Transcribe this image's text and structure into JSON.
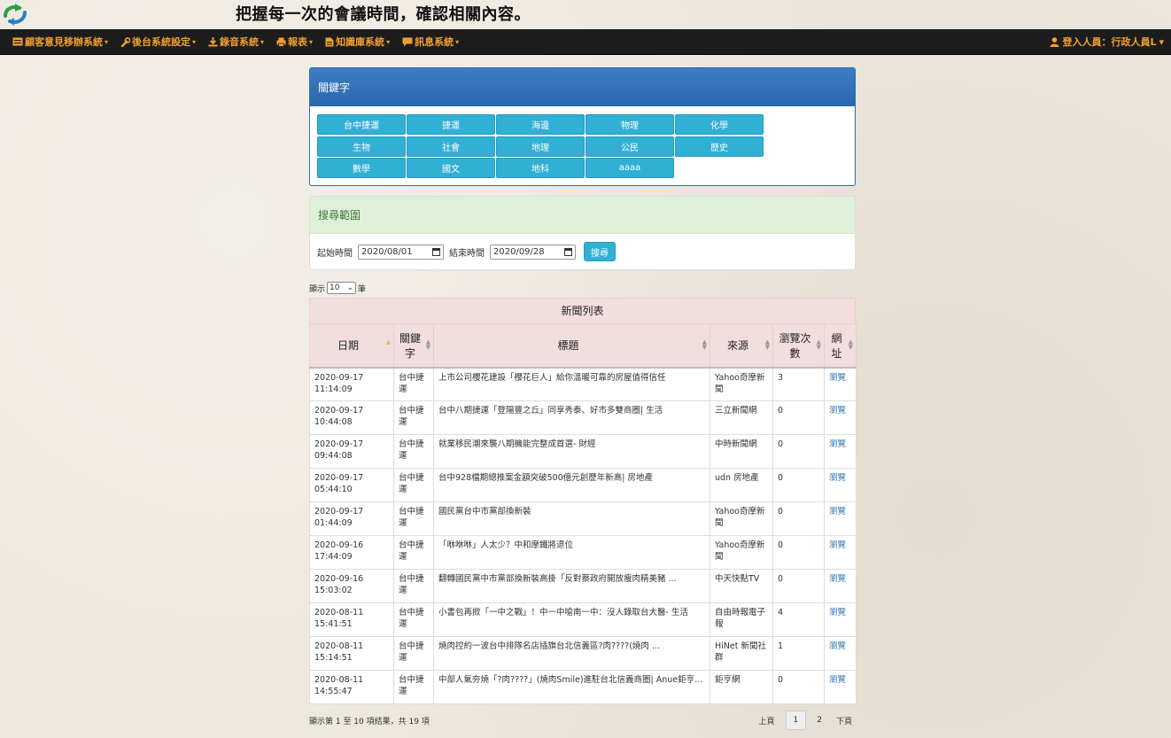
{
  "header": {
    "slogan": "把握每一次的會議時間，確認相關內容。"
  },
  "nav": {
    "items": [
      {
        "label": "顧客意見移辦系統",
        "icon": "card-icon"
      },
      {
        "label": "後台系統設定",
        "icon": "wrench-icon"
      },
      {
        "label": "錄音系統",
        "icon": "download-icon"
      },
      {
        "label": "報表",
        "icon": "printer-icon"
      },
      {
        "label": "知識庫系統",
        "icon": "document-icon"
      },
      {
        "label": "訊息系統",
        "icon": "comment-icon"
      }
    ],
    "caret": "▾",
    "user_label": "登入人員：行政人員L",
    "colors": {
      "bar": "#1c1c1c",
      "text": "#f0a030"
    }
  },
  "keywords": {
    "title": "關鍵字",
    "items": [
      "台中捷運",
      "捷運",
      "海邊",
      "物理",
      "化學",
      "生物",
      "社會",
      "地理",
      "公民",
      "歷史",
      "數學",
      "國文",
      "地科",
      "aaaa"
    ]
  },
  "search": {
    "title": "搜尋範圍",
    "start_label": "起始時間",
    "start_value": "2020/08/01",
    "end_label": "結束時間",
    "end_value": "2020/09/28",
    "button": "搜尋"
  },
  "length": {
    "prefix": "顯示",
    "value": "10",
    "suffix": "筆"
  },
  "table": {
    "title": "新聞列表",
    "columns": [
      "日期",
      "關鍵字",
      "標題",
      "來源",
      "瀏覽次數",
      "網址"
    ],
    "rows": [
      {
        "date": "2020-09-17 11:14:09",
        "keyword": "台中捷運",
        "title": "上市公司櫻花建設「櫻花巨人」給你溫暖可靠的房屋值得信任",
        "source": "Yahoo奇摩新聞",
        "views": "3",
        "url": "瀏覽"
      },
      {
        "date": "2020-09-17 10:44:08",
        "keyword": "台中捷運",
        "title": "台中八期捷運「登陽豐之丘」同享秀泰、好市多雙商圈| 生活",
        "source": "三立新聞網",
        "views": "0",
        "url": "瀏覽"
      },
      {
        "date": "2020-09-17 09:44:08",
        "keyword": "台中捷運",
        "title": "就業移民潮來襲八期機能完整成首選- 財經",
        "source": "中時新聞網",
        "views": "0",
        "url": "瀏覽"
      },
      {
        "date": "2020-09-17 05:44:10",
        "keyword": "台中捷運",
        "title": "台中928檔期總推案金額突破500億元創歷年新高| 房地產",
        "source": "udn 房地產",
        "views": "0",
        "url": "瀏覽"
      },
      {
        "date": "2020-09-17 01:44:09",
        "keyword": "台中捷運",
        "title": "國民黨台中市黨部換新裝",
        "source": "Yahoo奇摩新聞",
        "views": "0",
        "url": "瀏覽"
      },
      {
        "date": "2020-09-16 17:44:09",
        "keyword": "台中捷運",
        "title": "「咻咻咻」人太少？中和摩鐵將退位",
        "source": "Yahoo奇摩新聞",
        "views": "0",
        "url": "瀏覽"
      },
      {
        "date": "2020-09-16 15:03:02",
        "keyword": "台中捷運",
        "title": "翻轉國民黨中市黨部換新裝高掛「反對蔡政府開放瘦肉精美豬 ...",
        "source": "中天快點TV",
        "views": "0",
        "url": "瀏覽"
      },
      {
        "date": "2020-08-11 15:41:51",
        "keyword": "台中捷運",
        "title": "小書包再掀「一中之戰」！中一中嗆南一中：沒人錄取台大醫- 生活",
        "source": "自由時報電子報",
        "views": "4",
        "url": "瀏覽"
      },
      {
        "date": "2020-08-11 15:14:51",
        "keyword": "台中捷運",
        "title": "燒肉控約一波台中排隊名店插旗台北信義區?肉????(燒肉 ...",
        "source": "HiNet 新聞社群",
        "views": "1",
        "url": "瀏覽"
      },
      {
        "date": "2020-08-11 14:55:47",
        "keyword": "台中捷運",
        "title": "中部人氣夯燒「?肉????」(燒肉Smile)進駐台北信義商圈| Anue鉅亨- 一手情報",
        "source": "鉅亨網",
        "views": "0",
        "url": "瀏覽"
      }
    ]
  },
  "footer": {
    "info": "顯示第 1 至 10 項結果，共 19 項",
    "prev": "上頁",
    "pages": [
      "1",
      "2"
    ],
    "next": "下頁"
  }
}
